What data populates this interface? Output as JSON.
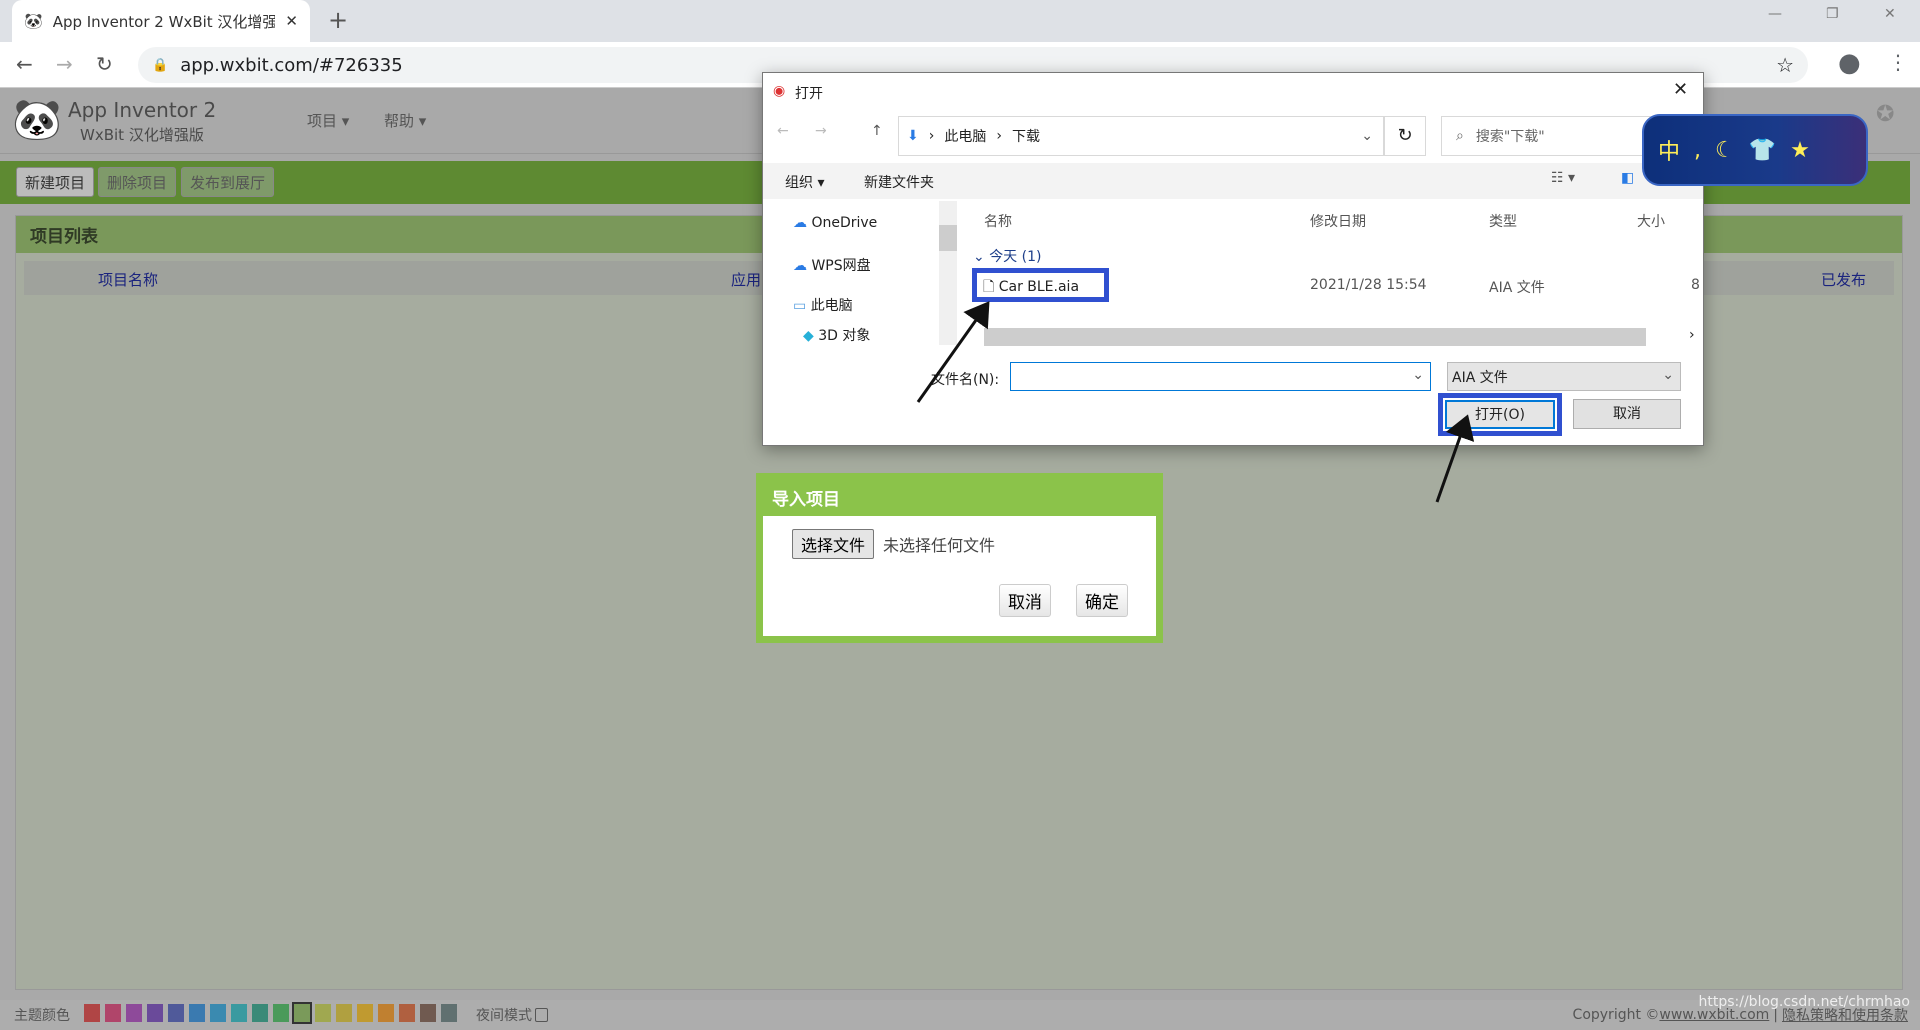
{
  "browser": {
    "tab_title": "App Inventor 2 WxBit 汉化增强",
    "url": "app.wxbit.com/#726335"
  },
  "app": {
    "title": "App Inventor 2",
    "subtitle": "WxBit 汉化增强版",
    "menus": [
      "项目 ▾",
      "帮助 ▾"
    ],
    "toolbar": [
      "新建项目",
      "删除项目",
      "发布到展厅"
    ],
    "project_list": {
      "title": "项目列表",
      "columns": [
        "项目名称",
        "应用",
        "已发布"
      ]
    },
    "footer": {
      "theme_label": "主题颜色",
      "night_label": "夜间模式",
      "copyright": "Copyright © ",
      "copyright_link": "www.wxbit.com",
      "privacy": "隐私策略和使用条款",
      "watermark": "https://blog.csdn.net/chrmhao",
      "theme_colors": [
        "#b04545",
        "#b0456a",
        "#8e4a9a",
        "#6a4a9a",
        "#505a9a",
        "#3a7ab0",
        "#3a8ab0",
        "#3a9aa0",
        "#3a8a78",
        "#4a9a5a",
        "#7a9a5a",
        "#a0a850",
        "#b0a040",
        "#c09a30",
        "#c08030",
        "#b06040",
        "#705a50",
        "#607070"
      ]
    }
  },
  "file_dialog": {
    "title": "打开",
    "breadcrumb": [
      "此电脑",
      "下载"
    ],
    "search_placeholder": "搜索\"下载\"",
    "organize": "组织 ▾",
    "new_folder": "新建文件夹",
    "nav": [
      "OneDrive",
      "WPS网盘",
      "此电脑",
      "3D 对象"
    ],
    "columns": [
      "名称",
      "修改日期",
      "类型",
      "大小"
    ],
    "group": "今天 (1)",
    "files": [
      {
        "name": "Car BLE.aia",
        "date": "2021/1/28 15:54",
        "type": "AIA 文件",
        "size": "8"
      }
    ],
    "filename_label": "文件名(N):",
    "filename_value": "",
    "filetype": "AIA 文件",
    "open": "打开(O)",
    "cancel": "取消"
  },
  "import_dialog": {
    "title": "导入项目",
    "choose": "选择文件",
    "no_file": "未选择任何文件",
    "cancel": "取消",
    "ok": "确定"
  },
  "ime": {
    "lang": "中"
  },
  "accent": "#8bc34a",
  "highlight": "#3050d0"
}
